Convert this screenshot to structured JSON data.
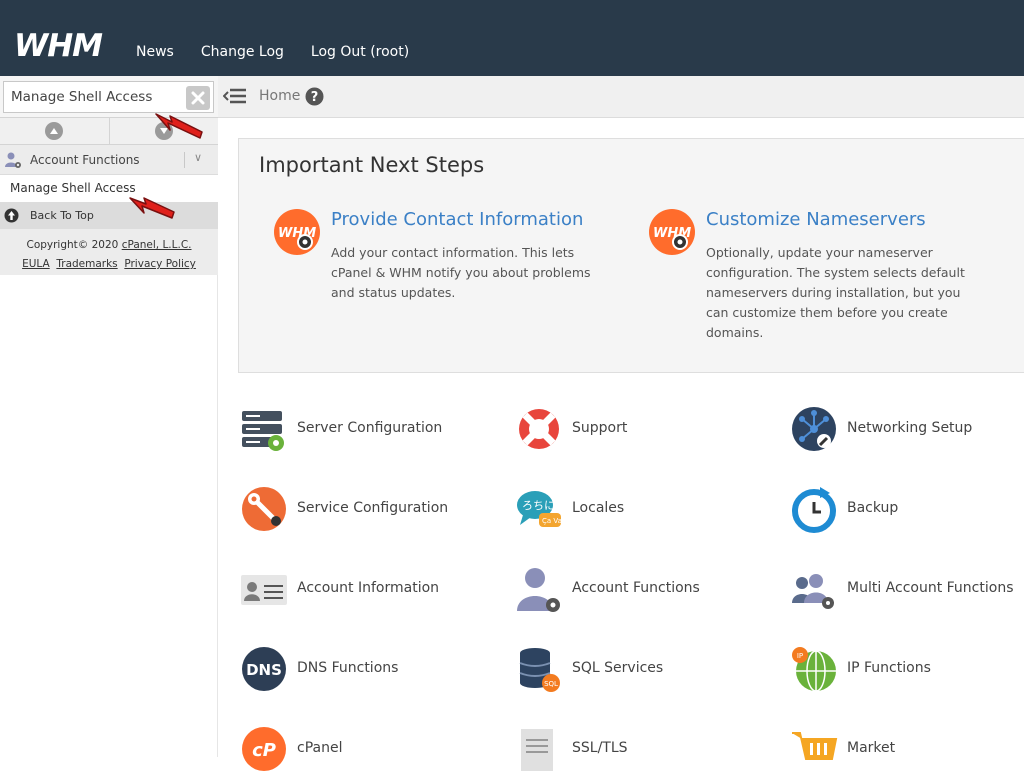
{
  "header": {
    "logo_text": "WHM",
    "nav": [
      "News",
      "Change Log",
      "Log Out (root)"
    ]
  },
  "sidebar": {
    "search_value": "Manage Shell Access",
    "category": "Account Functions",
    "active_item": "Manage Shell Access",
    "back_to_top": "Back To Top",
    "copyright": "Copyright© 2020 ",
    "company_link": "cPanel, L.L.C.",
    "footer_links": [
      "EULA",
      "Trademarks",
      "Privacy Policy"
    ]
  },
  "breadcrumb": {
    "home": "Home"
  },
  "next_steps": {
    "title": "Important Next Steps",
    "steps": [
      {
        "title": "Provide Contact Information",
        "description": "Add your contact information. This lets cPanel & WHM notify you about problems and status updates."
      },
      {
        "title": "Customize Nameservers",
        "description": "Optionally, update your nameserver configuration. The system selects default nameservers during installation, but you can customize them before you create domains."
      }
    ]
  },
  "categories": [
    "Server Configuration",
    "Support",
    "Networking Setup",
    "Service Configuration",
    "Locales",
    "Backup",
    "Account Information",
    "Account Functions",
    "Multi Account Functions",
    "DNS Functions",
    "SQL Services",
    "IP Functions",
    "cPanel",
    "SSL/TLS",
    "Market"
  ],
  "colors": {
    "topbar": "#293a4a",
    "accent_orange": "#ff6c2c",
    "link_blue": "#3b80c6",
    "annotation_red": "#e0201b"
  }
}
